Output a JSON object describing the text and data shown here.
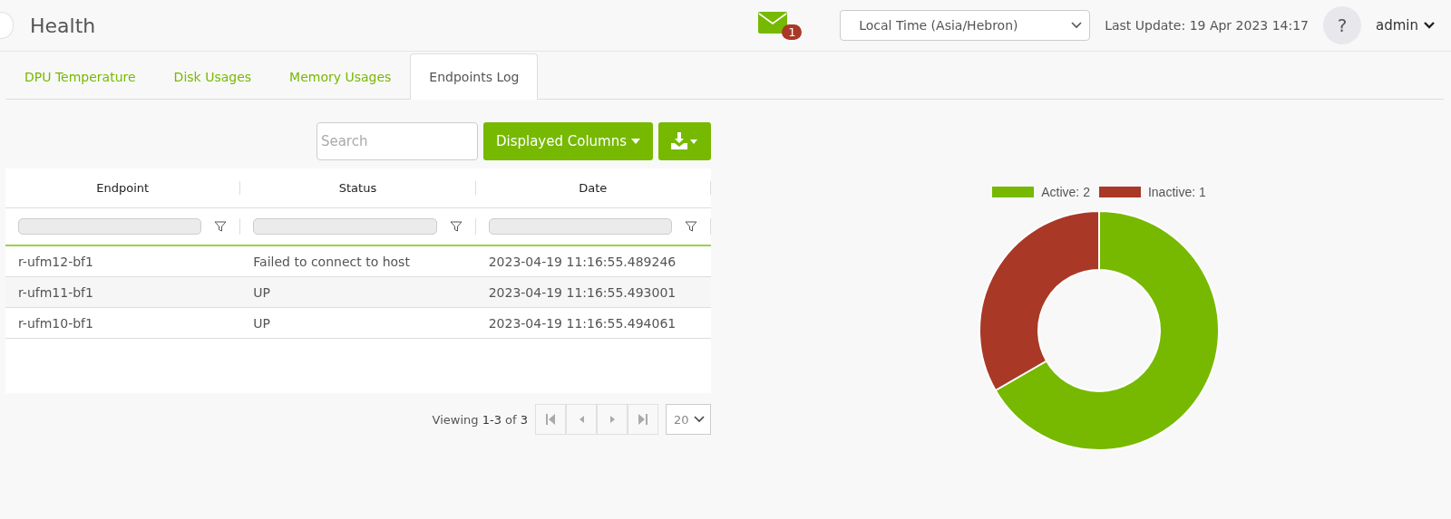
{
  "header": {
    "title": "Health",
    "notifications": {
      "count": "1"
    },
    "timezone": {
      "value": "Local Time (Asia/Hebron)"
    },
    "last_update": "Last Update: 19 Apr 2023 14:17",
    "help": "?",
    "user": "admin"
  },
  "tabs": [
    {
      "label": "DPU Temperature",
      "selected": false
    },
    {
      "label": "Disk Usages",
      "selected": false
    },
    {
      "label": "Memory Usages",
      "selected": false
    },
    {
      "label": "Endpoints Log",
      "selected": true
    }
  ],
  "toolbar": {
    "search": {
      "placeholder": "Search"
    },
    "columns_button": "Displayed Columns"
  },
  "table": {
    "columns": [
      "Endpoint",
      "Status",
      "Date"
    ],
    "rows": [
      [
        "r-ufm12-bf1",
        "Failed to connect to host",
        "2023-04-19 11:16:55.489246"
      ],
      [
        "r-ufm11-bf1",
        "UP",
        "2023-04-19 11:16:55.493001"
      ],
      [
        "r-ufm10-bf1",
        "UP",
        "2023-04-19 11:16:55.494061"
      ]
    ]
  },
  "pagination": {
    "summary": "Viewing **1-3** of **3**",
    "page_size": "20"
  },
  "chart_data": {
    "type": "donut",
    "categories": [
      "Active: 2",
      "Inactive: 1"
    ],
    "series": [
      {
        "values": [
          2,
          1
        ]
      }
    ],
    "colors": [
      "#76b900",
      "#a93827"
    ],
    "legend": true
  }
}
